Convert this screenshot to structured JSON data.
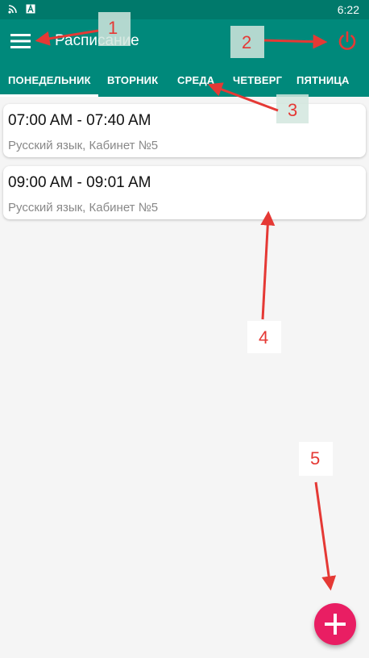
{
  "status_bar": {
    "time": "6:22",
    "icons": [
      "cast-icon",
      "notification-a-icon"
    ]
  },
  "app_bar": {
    "title": "Расписание",
    "menu_icon": "menu-icon",
    "power_icon": "power-icon"
  },
  "tabs": [
    {
      "label": "ПОНЕДЕЛЬНИК",
      "selected": true
    },
    {
      "label": "ВТОРНИК",
      "selected": false
    },
    {
      "label": "СРЕДА",
      "selected": false
    },
    {
      "label": "ЧЕТВЕРГ",
      "selected": false
    },
    {
      "label": "ПЯТНИЦА",
      "selected": false
    }
  ],
  "lessons": [
    {
      "time": "07:00 AM - 07:40 AM",
      "subtitle": "Русский язык, Кабинет №5"
    },
    {
      "time": "09:00 AM - 09:01 AM",
      "subtitle": "Русский язык, Кабинет №5"
    }
  ],
  "fab": {
    "icon": "plus-icon"
  },
  "annotations": [
    "1",
    "2",
    "3",
    "4",
    "5"
  ],
  "colors": {
    "primary": "#00897b",
    "status_bar": "#00796b",
    "power": "#e53935",
    "fab": "#e91e63",
    "annotation": "#e53935"
  }
}
